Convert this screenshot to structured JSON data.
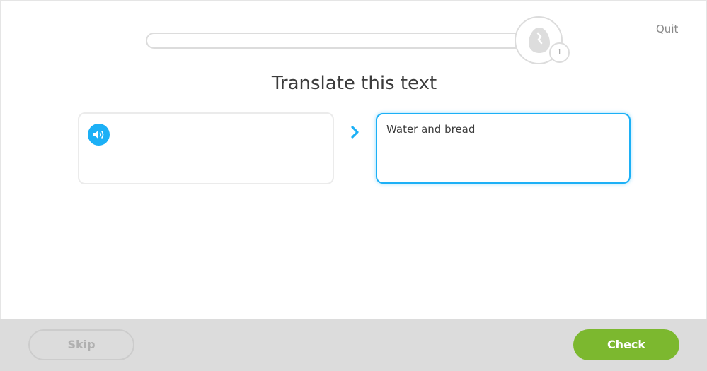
{
  "header": {
    "quit_label": "Quit",
    "progress_fraction": 0.0,
    "egg_icon": "egg-icon",
    "egg_count": "1"
  },
  "prompt": {
    "title": "Translate this text",
    "speaker_icon": "speaker-icon",
    "arrow_icon": "chevron-right-icon"
  },
  "answer": {
    "value": "Water and bread"
  },
  "footer": {
    "skip_label": "Skip",
    "check_label": "Check"
  },
  "colors": {
    "accent_blue": "#1cb0f6",
    "check_green": "#7cb82f",
    "footer_gray": "#dcdcdc"
  }
}
